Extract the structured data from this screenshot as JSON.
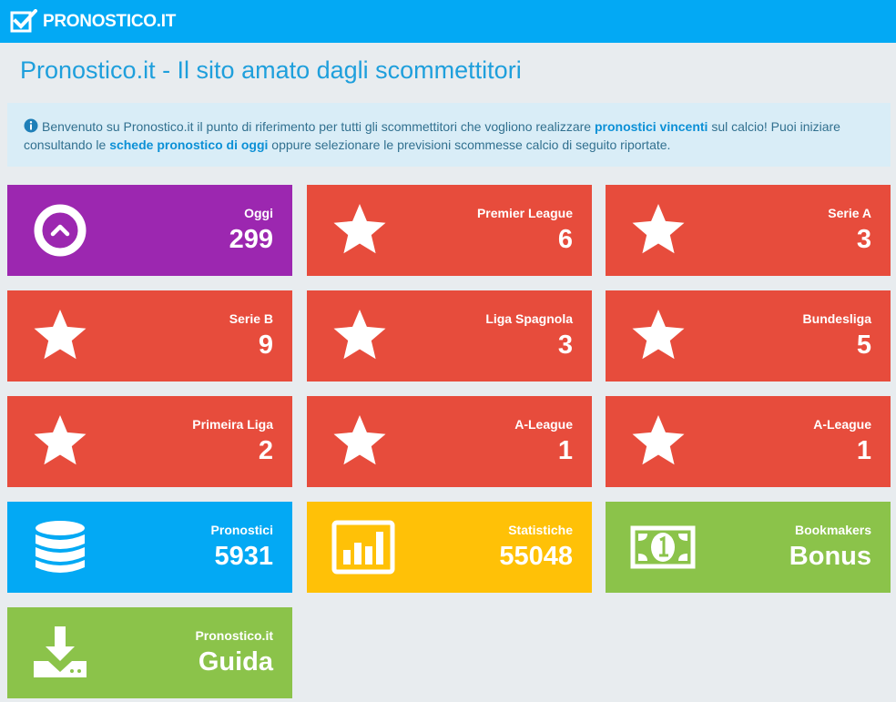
{
  "navbar": {
    "brand": "PRONOSTICO.IT"
  },
  "page": {
    "title": "Pronostico.it - Il sito amato dagli scommettitori"
  },
  "info": {
    "text1": "Benvenuto su Pronostico.it il punto di riferimento per tutti gli scommettitori che vogliono realizzare ",
    "strong1": "pronostici vincenti",
    "text2": " sul calcio! Puoi iniziare consultando le ",
    "link1": "schede pronostico di oggi",
    "text3": " oppure selezionare le previsioni scommesse calcio di seguito riportate."
  },
  "tiles": [
    {
      "label": "Oggi",
      "value": "299",
      "icon": "chevron-up-circle-icon",
      "color": "#9c27b0"
    },
    {
      "label": "Premier League",
      "value": "6",
      "icon": "star-icon",
      "color": "#e74c3c"
    },
    {
      "label": "Serie A",
      "value": "3",
      "icon": "star-icon",
      "color": "#e74c3c"
    },
    {
      "label": "Serie B",
      "value": "9",
      "icon": "star-icon",
      "color": "#e74c3c"
    },
    {
      "label": "Liga Spagnola",
      "value": "3",
      "icon": "star-icon",
      "color": "#e74c3c"
    },
    {
      "label": "Bundesliga",
      "value": "5",
      "icon": "star-icon",
      "color": "#e74c3c"
    },
    {
      "label": "Primeira Liga",
      "value": "2",
      "icon": "star-icon",
      "color": "#e74c3c"
    },
    {
      "label": "A-League",
      "value": "1",
      "icon": "star-icon",
      "color": "#e74c3c"
    },
    {
      "label": "A-League",
      "value": "1",
      "icon": "star-icon",
      "color": "#e74c3c"
    },
    {
      "label": "Pronostici",
      "value": "5931",
      "icon": "database-icon",
      "color": "#03a9f4"
    },
    {
      "label": "Statistiche",
      "value": "55048",
      "icon": "bar-chart-icon",
      "color": "#ffc107"
    },
    {
      "label": "Bookmakers",
      "value": "Bonus",
      "icon": "money-icon",
      "color": "#8bc34a"
    },
    {
      "label": "Pronostico.it",
      "value": "Guida",
      "icon": "download-icon",
      "color": "#8bc34a"
    }
  ]
}
